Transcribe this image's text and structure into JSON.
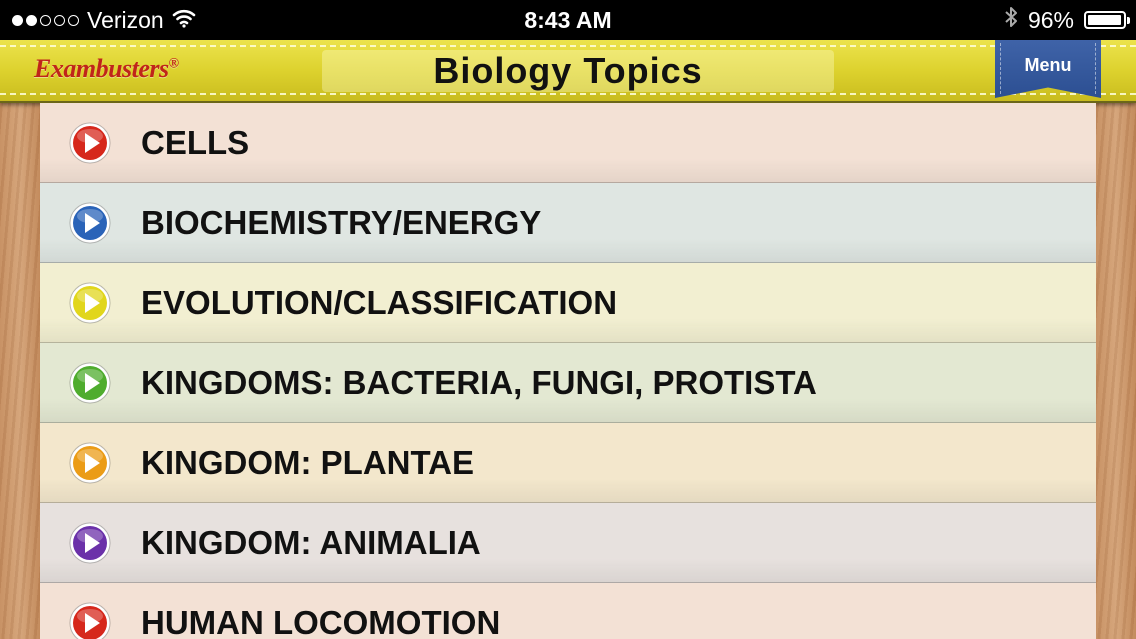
{
  "status_bar": {
    "carrier": "Verizon",
    "time": "8:43 AM",
    "battery": "96%",
    "battery_level": 0.96,
    "signal_dots_filled": 2,
    "signal_dots_total": 5,
    "icons": [
      "wifi-icon",
      "bluetooth-icon",
      "battery-icon"
    ]
  },
  "header": {
    "brand": "Exambusters",
    "brand_mark": "®",
    "title": "Biology Topics",
    "menu_label": "Menu",
    "colors": {
      "bar": "#ddd22e",
      "brand_text": "#c0251a",
      "menu_ribbon": "#2c4f92"
    }
  },
  "topics": [
    {
      "label": "CELLS",
      "icon": "play-icon",
      "icon_color": "#d6281c",
      "row_color": "#f3e1d5"
    },
    {
      "label": "BIOCHEMISTRY/ENERGY",
      "icon": "play-icon",
      "icon_color": "#2a63b8",
      "row_color": "#dfe6e2"
    },
    {
      "label": "EVOLUTION/CLASSIFICATION",
      "icon": "play-icon",
      "icon_color": "#e1d61c",
      "row_color": "#f2efd1"
    },
    {
      "label": "KINGDOMS: BACTERIA, FUNGI, PROTISTA",
      "icon": "play-icon",
      "icon_color": "#4fac2e",
      "row_color": "#e3e8d2"
    },
    {
      "label": "KINGDOM: PLANTAE",
      "icon": "play-icon",
      "icon_color": "#eb9c17",
      "row_color": "#f3e7cc"
    },
    {
      "label": "KINGDOM: ANIMALIA",
      "icon": "play-icon",
      "icon_color": "#6b31a9",
      "row_color": "#e7e1de"
    },
    {
      "label": "HUMAN LOCOMOTION",
      "icon": "play-icon",
      "icon_color": "#d6281c",
      "row_color": "#f3e1d5"
    }
  ]
}
